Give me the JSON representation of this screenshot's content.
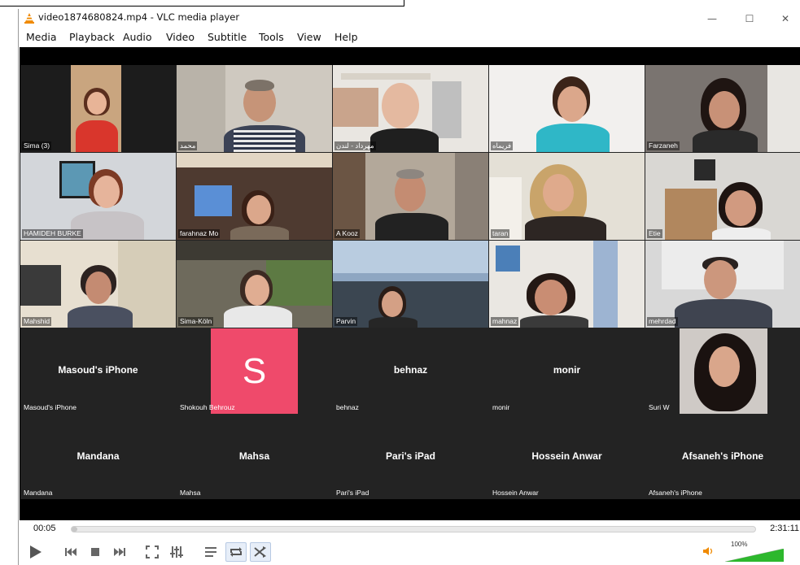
{
  "window": {
    "title": "video1874680824.mp4 - VLC media player",
    "minimize": "—",
    "maximize": "☐",
    "close": "✕"
  },
  "menu": [
    "Media",
    "Playback",
    "Audio",
    "Video",
    "Subtitle",
    "Tools",
    "View",
    "Help"
  ],
  "participants": {
    "row1": [
      "Sima (3)",
      "محمد",
      "مهرداد - لندن",
      "فریماه",
      "Farzaneh"
    ],
    "row2": [
      "HAMIDEH BURKE",
      "farahnaz Mo",
      "A Kooz",
      "taran",
      "Etie"
    ],
    "row3": [
      "Mahshid",
      "Sima-Köln",
      "Parvin",
      "mahnaz",
      "mehrdad"
    ],
    "row4": [
      {
        "center": "Masoud's iPhone",
        "label": "Masoud's iPhone"
      },
      {
        "avatar_letter": "S",
        "label": "Shokouh Behrouz"
      },
      {
        "center": "behnaz",
        "label": "behnaz"
      },
      {
        "center": "monir",
        "label": "monir"
      },
      {
        "label": "Suri W"
      }
    ],
    "row5": [
      {
        "center": "Mandana",
        "label": "Mandana"
      },
      {
        "center": "Mahsa",
        "label": "Mahsa"
      },
      {
        "center": "Pari's iPad",
        "label": "Pari's iPad"
      },
      {
        "center": "Hossein Anwar",
        "label": "Hossein Anwar"
      },
      {
        "center": "Afsaneh's iPhone",
        "label": "Afsaneh's iPhone"
      }
    ]
  },
  "playback": {
    "elapsed": "00:05",
    "total": "2:31:11",
    "progress_fraction": 0.0006,
    "volume_label": "100%"
  },
  "colors": {
    "avatar_bg": "#ef4a6b",
    "accent_orange": "#f08a00",
    "volume_green": "#2db82d"
  }
}
